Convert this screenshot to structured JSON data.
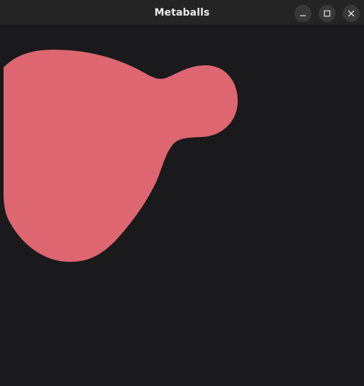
{
  "window": {
    "title": "Metaballs",
    "controls": {
      "minimize": "minimize-icon",
      "maximize": "maximize-icon",
      "close": "close-icon"
    }
  },
  "canvas": {
    "background_color": "#1a1a1c",
    "blob_color": "#dd6670"
  }
}
